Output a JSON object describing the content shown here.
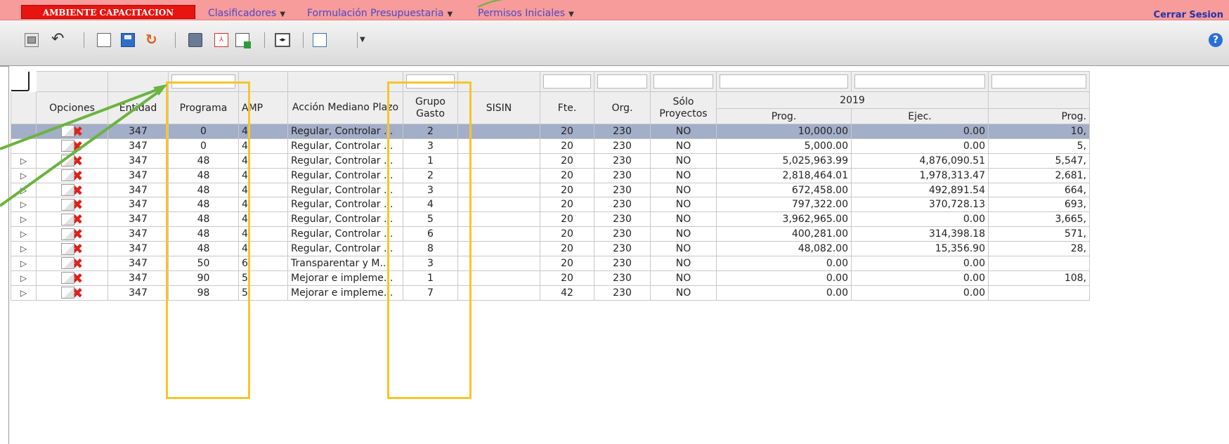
{
  "menubar": {
    "env_label": "AMBIENTE CAPACITACION",
    "menus": [
      {
        "label": "Clasificadores"
      },
      {
        "label": "Formulación Presupuestaria"
      },
      {
        "label": "Permisos Iniciales"
      }
    ],
    "logout_label": "Cerrar Sesion"
  },
  "toolbar": {
    "icons": [
      "monitor-icon",
      "undo-icon",
      "new-document-icon",
      "save-icon",
      "refresh-icon",
      "print-icon",
      "pdf-icon",
      "excel-export-icon",
      "expand-icon",
      "document-menu-icon"
    ],
    "help_label": "?"
  },
  "grid": {
    "headers": {
      "opciones": "Opciones",
      "entidad": "Entidad",
      "programa": "Programa",
      "amp": "AMP",
      "accion": "Acción Mediano Plazo",
      "grupo": "Grupo Gasto",
      "sisin": "SISIN",
      "fte": "Fte.",
      "org": "Org.",
      "solo": "Sólo Proyectos",
      "year": "2019",
      "prog": "Prog.",
      "ejec": "Ejec.",
      "prog2": "Prog."
    },
    "rows": [
      {
        "entidad": "347",
        "programa": "0",
        "amp": "4",
        "accion": "Regular, Controlar ...",
        "grupo": "2",
        "sisin": "",
        "fte": "20",
        "org": "230",
        "solo": "NO",
        "prog": "10,000.00",
        "ejec": "0.00",
        "prog2": "10,"
      },
      {
        "entidad": "347",
        "programa": "0",
        "amp": "4",
        "accion": "Regular, Controlar ...",
        "grupo": "3",
        "sisin": "",
        "fte": "20",
        "org": "230",
        "solo": "NO",
        "prog": "5,000.00",
        "ejec": "0.00",
        "prog2": "5,"
      },
      {
        "entidad": "347",
        "programa": "48",
        "amp": "4",
        "accion": "Regular, Controlar ...",
        "grupo": "1",
        "sisin": "",
        "fte": "20",
        "org": "230",
        "solo": "NO",
        "prog": "5,025,963.99",
        "ejec": "4,876,090.51",
        "prog2": "5,547,"
      },
      {
        "entidad": "347",
        "programa": "48",
        "amp": "4",
        "accion": "Regular, Controlar ...",
        "grupo": "2",
        "sisin": "",
        "fte": "20",
        "org": "230",
        "solo": "NO",
        "prog": "2,818,464.01",
        "ejec": "1,978,313.47",
        "prog2": "2,681,"
      },
      {
        "entidad": "347",
        "programa": "48",
        "amp": "4",
        "accion": "Regular, Controlar ...",
        "grupo": "3",
        "sisin": "",
        "fte": "20",
        "org": "230",
        "solo": "NO",
        "prog": "672,458.00",
        "ejec": "492,891.54",
        "prog2": "664,"
      },
      {
        "entidad": "347",
        "programa": "48",
        "amp": "4",
        "accion": "Regular, Controlar ...",
        "grupo": "4",
        "sisin": "",
        "fte": "20",
        "org": "230",
        "solo": "NO",
        "prog": "797,322.00",
        "ejec": "370,728.13",
        "prog2": "693,"
      },
      {
        "entidad": "347",
        "programa": "48",
        "amp": "4",
        "accion": "Regular, Controlar ...",
        "grupo": "5",
        "sisin": "",
        "fte": "20",
        "org": "230",
        "solo": "NO",
        "prog": "3,962,965.00",
        "ejec": "0.00",
        "prog2": "3,665,"
      },
      {
        "entidad": "347",
        "programa": "48",
        "amp": "4",
        "accion": "Regular, Controlar ...",
        "grupo": "6",
        "sisin": "",
        "fte": "20",
        "org": "230",
        "solo": "NO",
        "prog": "400,281.00",
        "ejec": "314,398.18",
        "prog2": "571,"
      },
      {
        "entidad": "347",
        "programa": "48",
        "amp": "4",
        "accion": "Regular, Controlar ...",
        "grupo": "8",
        "sisin": "",
        "fte": "20",
        "org": "230",
        "solo": "NO",
        "prog": "48,082.00",
        "ejec": "15,356.90",
        "prog2": "28,"
      },
      {
        "entidad": "347",
        "programa": "50",
        "amp": "6",
        "accion": "Transparentar y M...",
        "grupo": "3",
        "sisin": "",
        "fte": "20",
        "org": "230",
        "solo": "NO",
        "prog": "0.00",
        "ejec": "0.00",
        "prog2": ""
      },
      {
        "entidad": "347",
        "programa": "90",
        "amp": "5",
        "accion": "Mejorar e impleme...",
        "grupo": "1",
        "sisin": "",
        "fte": "20",
        "org": "230",
        "solo": "NO",
        "prog": "0.00",
        "ejec": "0.00",
        "prog2": "108,"
      },
      {
        "entidad": "347",
        "programa": "98",
        "amp": "5",
        "accion": "Mejorar e impleme...",
        "grupo": "7",
        "sisin": "",
        "fte": "42",
        "org": "230",
        "solo": "NO",
        "prog": "0.00",
        "ejec": "0.00",
        "prog2": ""
      }
    ]
  },
  "colors": {
    "menubar_bg": "#f79b9b",
    "env_badge_bg": "#e8140f",
    "selected_row_bg": "#a3aec8",
    "highlight_box": "#f7c52a",
    "callout_arrow": "#6cb33f"
  }
}
